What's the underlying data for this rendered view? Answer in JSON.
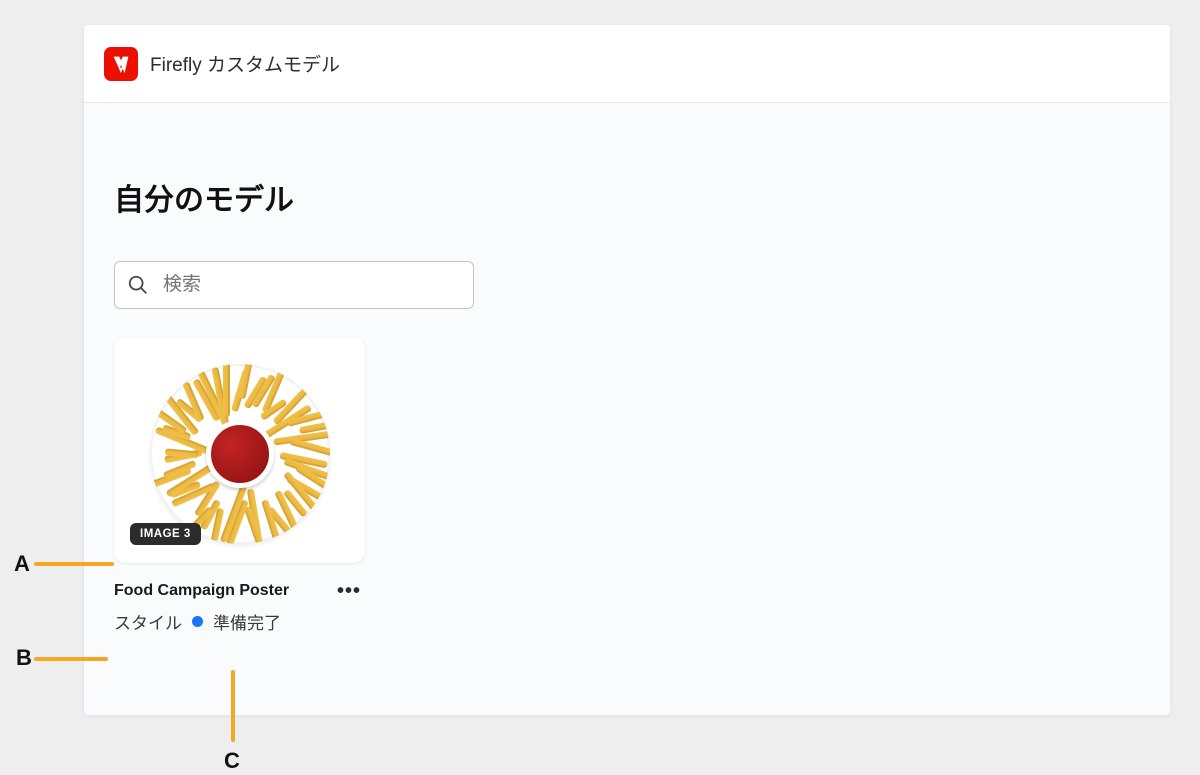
{
  "header": {
    "app_title": "Firefly カスタムモデル"
  },
  "page": {
    "heading": "自分のモデル"
  },
  "search": {
    "placeholder": "検索"
  },
  "card": {
    "badge": "IMAGE 3",
    "title": "Food Campaign Poster",
    "type_label": "スタイル",
    "status_label": "準備完了",
    "status_color": "#1676f3"
  },
  "annotations": {
    "a": "A",
    "b": "B",
    "c": "C"
  }
}
